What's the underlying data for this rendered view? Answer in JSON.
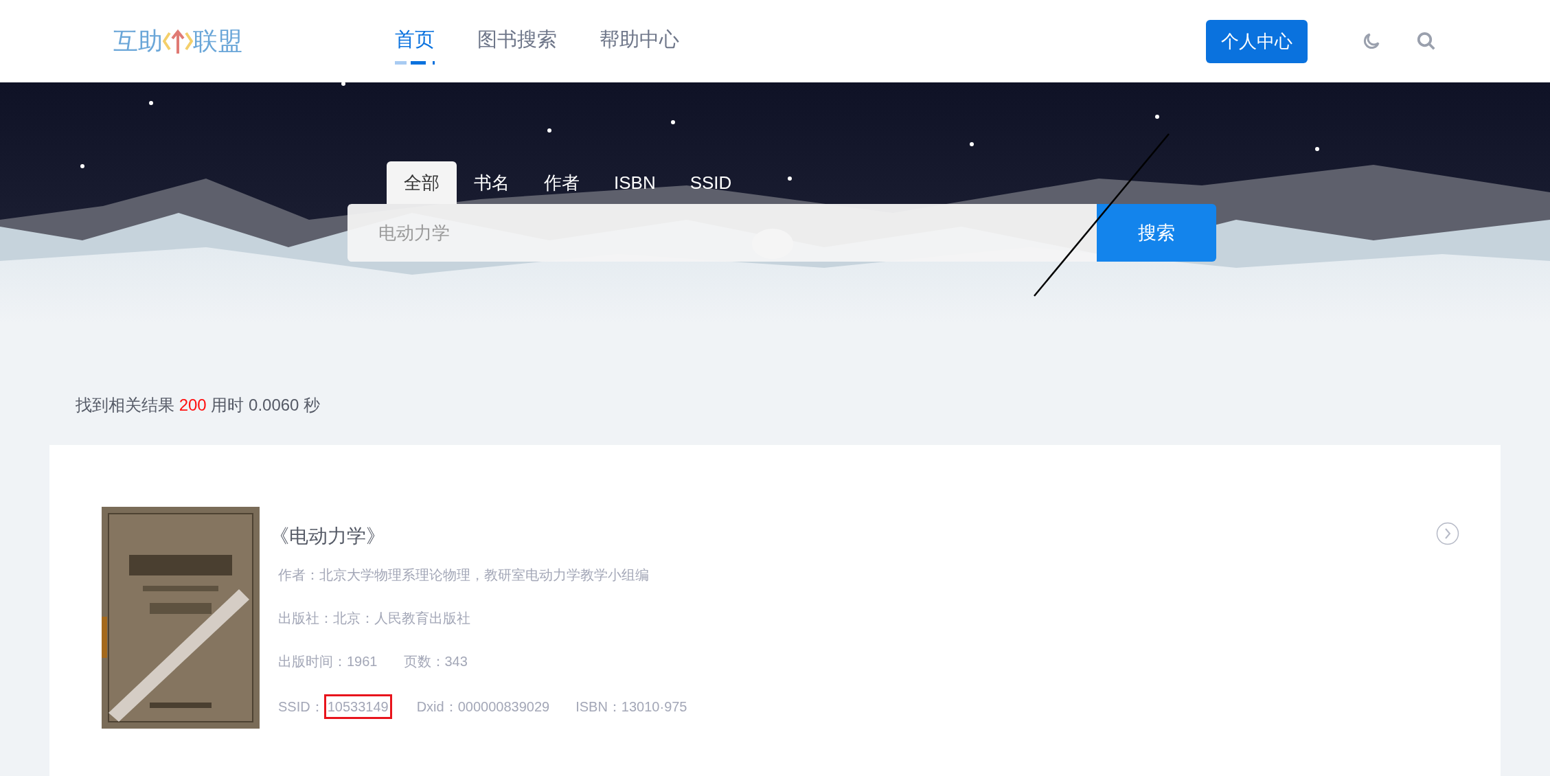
{
  "header": {
    "logo": {
      "left": "互助",
      "right": "联盟"
    },
    "nav": [
      {
        "label": "首页",
        "selected": true
      },
      {
        "label": "图书搜索",
        "selected": false
      },
      {
        "label": "帮助中心",
        "selected": false
      }
    ],
    "account_button": "个人中心"
  },
  "search": {
    "tabs": [
      {
        "label": "全部",
        "selected": true
      },
      {
        "label": "书名",
        "selected": false
      },
      {
        "label": "作者",
        "selected": false
      },
      {
        "label": "ISBN",
        "selected": false
      },
      {
        "label": "SSID",
        "selected": false
      }
    ],
    "query": "电动力学",
    "button": "搜索"
  },
  "summary": {
    "prefix": "找到相关结果",
    "count": "200",
    "suffix": "用时 0.0060 秒"
  },
  "results": [
    {
      "title": "《电动力学》",
      "author": "作者：北京大学物理系理论物理，教研室电动力学教学小组编",
      "publisher": "出版社：北京：人民教育出版社",
      "year": "出版时间：1961",
      "pages": "页数：343",
      "ssid_label": "SSID：",
      "ssid": "10533149",
      "ssid_highlighted": true,
      "dxid": "Dxid：000000839029",
      "isbn": "ISBN：13010·975"
    }
  ]
}
